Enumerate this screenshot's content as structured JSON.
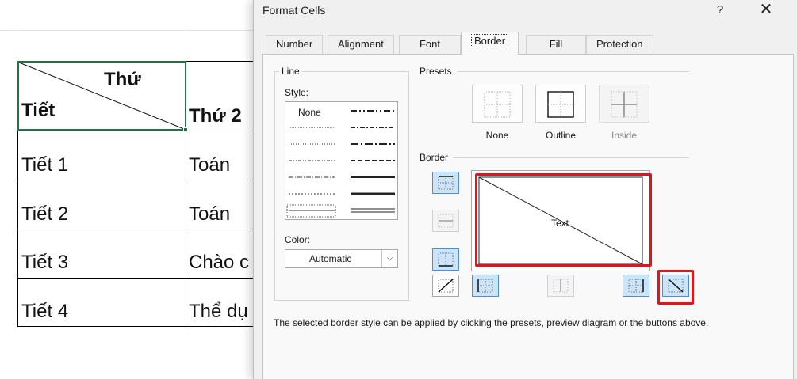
{
  "spreadsheet": {
    "header_top_right": "Thứ",
    "header_bottom_left": "Tiết",
    "col2_header": "Thứ 2",
    "rows": [
      {
        "period": "Tiết 1",
        "subject": "Toán"
      },
      {
        "period": "Tiết 2",
        "subject": "Toán"
      },
      {
        "period": "Tiết 3",
        "subject": "Chào c"
      },
      {
        "period": "Tiết 4",
        "subject": "Thể dụ"
      }
    ]
  },
  "dialog": {
    "title": "Format Cells",
    "help": "?",
    "close": "✕",
    "tabs": [
      {
        "label": "Number"
      },
      {
        "label": "Alignment"
      },
      {
        "label": "Font"
      },
      {
        "label": "Border"
      },
      {
        "label": "Fill"
      },
      {
        "label": "Protection"
      }
    ],
    "line_group": {
      "title": "Line",
      "style_label": "Style:",
      "style_none": "None",
      "color_label": "Color:",
      "color_value": "Automatic",
      "color_arrow": "⌵"
    },
    "presets": {
      "title": "Presets",
      "none_label": "None",
      "outline_label": "Outline",
      "inside_label": "Inside"
    },
    "border": {
      "title": "Border",
      "preview_text": "Text"
    },
    "info": "The selected border style can be applied by clicking the presets, preview diagram or the buttons above."
  },
  "colors": {
    "highlight_red": "#e2141b",
    "selection_green": "#217346",
    "toggle_on": "#cce4f7"
  }
}
